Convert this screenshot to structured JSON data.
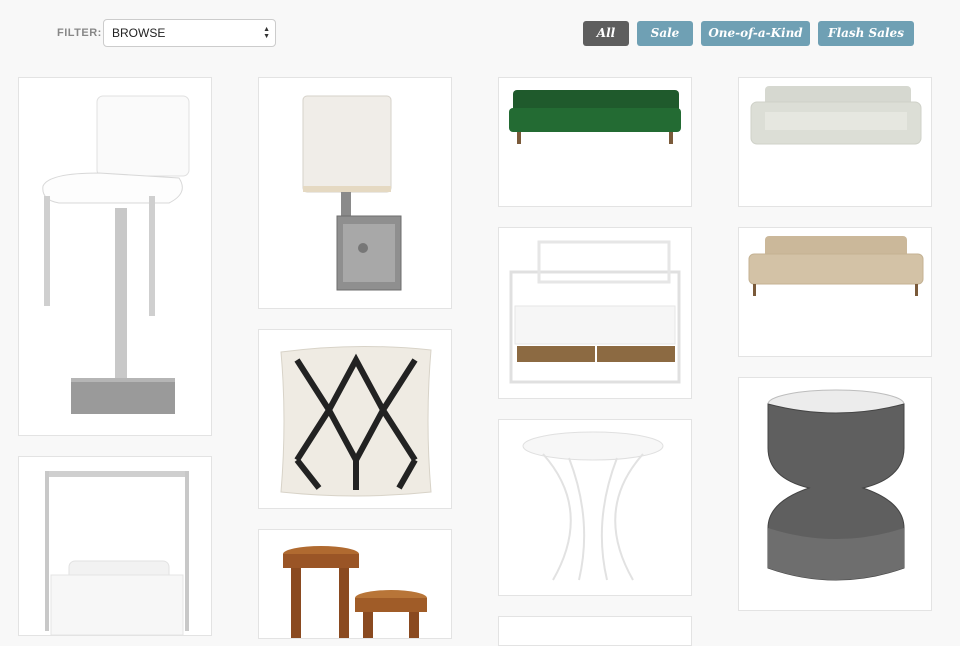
{
  "filter": {
    "label": "FILTER:",
    "selected": "BROWSE"
  },
  "tabs": [
    {
      "label": "All",
      "active": true
    },
    {
      "label": "Sale",
      "active": false
    },
    {
      "label": "One-of-a-Kind",
      "active": false
    },
    {
      "label": "Flash Sales",
      "active": false
    }
  ],
  "colors": {
    "active_tab": "#5e5e5e",
    "tab": "#6fa0b4",
    "background": "#f8f8f8"
  },
  "products": [
    {
      "name": "bar-stool",
      "icon": "white-bar-stool"
    },
    {
      "name": "canopy-bed",
      "icon": "silver-canopy-bed"
    },
    {
      "name": "wall-sconce",
      "icon": "wall-sconce-lamp"
    },
    {
      "name": "throw-pillow",
      "icon": "black-trellis-pillow"
    },
    {
      "name": "wooden-stools",
      "icon": "teak-stools"
    },
    {
      "name": "green-sofa",
      "icon": "green-velvet-sofa"
    },
    {
      "name": "white-bed",
      "icon": "white-metal-bed"
    },
    {
      "name": "side-table",
      "icon": "white-wire-table"
    },
    {
      "name": "gray-sofa",
      "icon": "light-gray-sofa"
    },
    {
      "name": "beige-sofa",
      "icon": "beige-sofa"
    },
    {
      "name": "drum-table",
      "icon": "metal-hourglass-table"
    }
  ]
}
